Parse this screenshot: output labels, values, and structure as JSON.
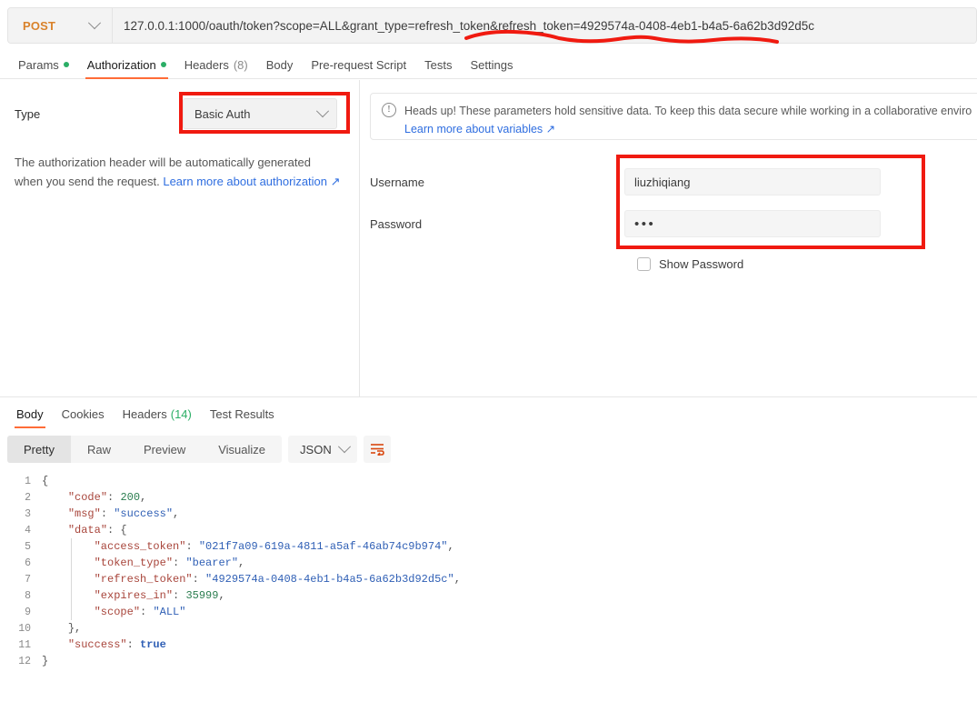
{
  "request_bar": {
    "method": "POST",
    "method_color": "#d9822b",
    "url": "127.0.0.1:1000/oauth/token?scope=ALL&grant_type=refresh_token&refresh_token=4929574a-0408-4eb1-b4a5-6a62b3d92d5c",
    "chevron_icon": "chevron-down-icon"
  },
  "request_tabs": [
    {
      "label": "Params",
      "has_dot": true,
      "active": false
    },
    {
      "label": "Authorization",
      "has_dot": true,
      "active": true
    },
    {
      "label": "Headers",
      "count": "(8)",
      "has_dot": false,
      "active": false
    },
    {
      "label": "Body",
      "has_dot": false,
      "active": false
    },
    {
      "label": "Pre-request Script",
      "has_dot": false,
      "active": false
    },
    {
      "label": "Tests",
      "has_dot": false,
      "active": false
    },
    {
      "label": "Settings",
      "has_dot": false,
      "active": false
    }
  ],
  "auth": {
    "type_label": "Type",
    "type_value": "Basic Auth",
    "hint_text": "The authorization header will be automatically generated when you send the request. ",
    "hint_link": "Learn more about authorization ↗",
    "notice_text": "Heads up! These parameters hold sensitive data. To keep this data secure while working in a collaborative enviro",
    "notice_link": "Learn more about variables ↗",
    "notice_icon": "info-circle-icon",
    "username_label": "Username",
    "username_value": "liuzhiqiang",
    "password_label": "Password",
    "password_value": "•••",
    "show_password_label": "Show Password",
    "show_password_checked": false
  },
  "response_tabs": [
    {
      "label": "Body",
      "active": true
    },
    {
      "label": "Cookies",
      "active": false
    },
    {
      "label": "Headers",
      "count": "(14)",
      "active": false
    },
    {
      "label": "Test Results",
      "active": false
    }
  ],
  "view_modes": [
    {
      "label": "Pretty",
      "active": true
    },
    {
      "label": "Raw",
      "active": false
    },
    {
      "label": "Preview",
      "active": false
    },
    {
      "label": "Visualize",
      "active": false
    }
  ],
  "format_select": "JSON",
  "wrap_icon": "wrap-lines-icon",
  "accent_color": "#ff6c37",
  "annotation_color": "#f01a10",
  "response_body": [
    {
      "n": "1",
      "indent": 0,
      "parts": [
        {
          "t": "punc",
          "v": "{"
        }
      ]
    },
    {
      "n": "2",
      "indent": 1,
      "parts": [
        {
          "t": "key",
          "v": "\"code\""
        },
        {
          "t": "punc",
          "v": ": "
        },
        {
          "t": "num",
          "v": "200"
        },
        {
          "t": "punc",
          "v": ","
        }
      ]
    },
    {
      "n": "3",
      "indent": 1,
      "parts": [
        {
          "t": "key",
          "v": "\"msg\""
        },
        {
          "t": "punc",
          "v": ": "
        },
        {
          "t": "str",
          "v": "\"success\""
        },
        {
          "t": "punc",
          "v": ","
        }
      ]
    },
    {
      "n": "4",
      "indent": 1,
      "parts": [
        {
          "t": "key",
          "v": "\"data\""
        },
        {
          "t": "punc",
          "v": ": {"
        }
      ]
    },
    {
      "n": "5",
      "indent": 2,
      "parts": [
        {
          "t": "key",
          "v": "\"access_token\""
        },
        {
          "t": "punc",
          "v": ": "
        },
        {
          "t": "str",
          "v": "\"021f7a09-619a-4811-a5af-46ab74c9b974\""
        },
        {
          "t": "punc",
          "v": ","
        }
      ]
    },
    {
      "n": "6",
      "indent": 2,
      "parts": [
        {
          "t": "key",
          "v": "\"token_type\""
        },
        {
          "t": "punc",
          "v": ": "
        },
        {
          "t": "str",
          "v": "\"bearer\""
        },
        {
          "t": "punc",
          "v": ","
        }
      ]
    },
    {
      "n": "7",
      "indent": 2,
      "parts": [
        {
          "t": "key",
          "v": "\"refresh_token\""
        },
        {
          "t": "punc",
          "v": ": "
        },
        {
          "t": "str",
          "v": "\"4929574a-0408-4eb1-b4a5-6a62b3d92d5c\""
        },
        {
          "t": "punc",
          "v": ","
        }
      ]
    },
    {
      "n": "8",
      "indent": 2,
      "parts": [
        {
          "t": "key",
          "v": "\"expires_in\""
        },
        {
          "t": "punc",
          "v": ": "
        },
        {
          "t": "num",
          "v": "35999"
        },
        {
          "t": "punc",
          "v": ","
        }
      ]
    },
    {
      "n": "9",
      "indent": 2,
      "parts": [
        {
          "t": "key",
          "v": "\"scope\""
        },
        {
          "t": "punc",
          "v": ": "
        },
        {
          "t": "str",
          "v": "\"ALL\""
        }
      ]
    },
    {
      "n": "10",
      "indent": 1,
      "parts": [
        {
          "t": "punc",
          "v": "},"
        }
      ]
    },
    {
      "n": "11",
      "indent": 1,
      "parts": [
        {
          "t": "key",
          "v": "\"success\""
        },
        {
          "t": "punc",
          "v": ": "
        },
        {
          "t": "bool",
          "v": "true"
        }
      ]
    },
    {
      "n": "12",
      "indent": 0,
      "parts": [
        {
          "t": "punc",
          "v": "}"
        }
      ]
    }
  ]
}
